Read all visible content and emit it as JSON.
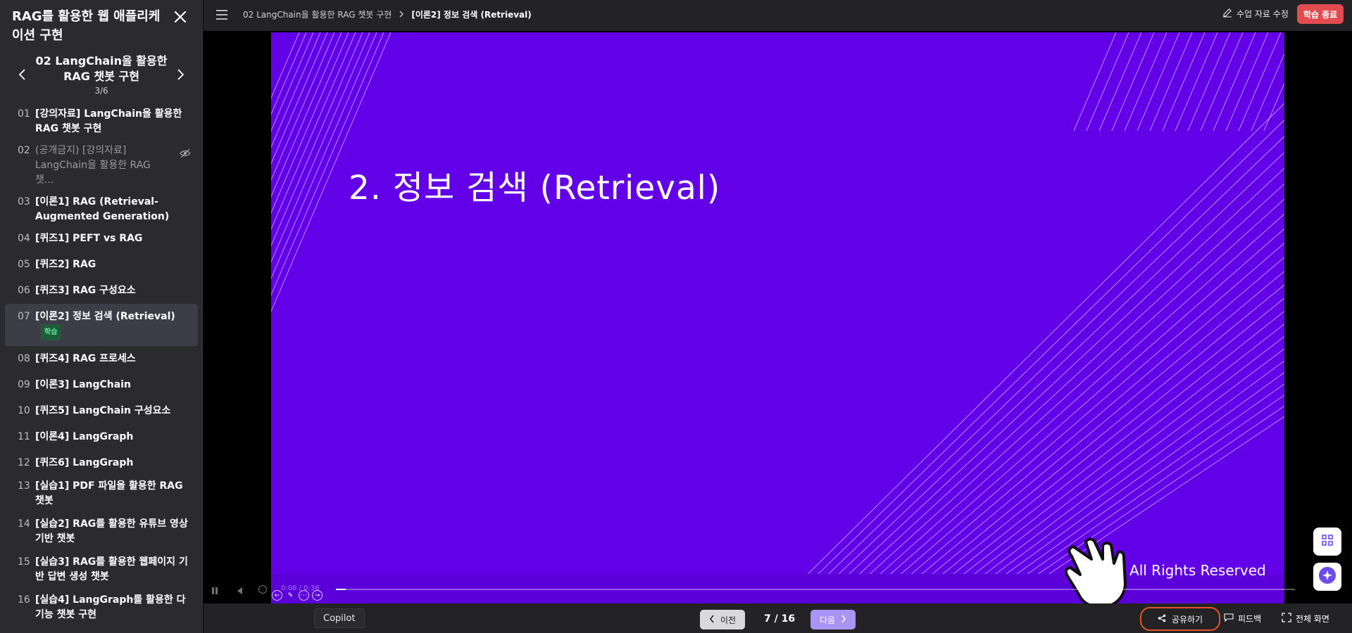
{
  "sidebar": {
    "course_title": "RAG를 활용한 웹 애플리케이션 구현",
    "chapter_title": "02 LangChain을 활용한 RAG 챗봇 구현",
    "chapter_count": "3/6",
    "lessons": [
      {
        "num": "01",
        "label": "[강의자료] LangChain을 활용한 RAG 챗봇 구현"
      },
      {
        "num": "02",
        "label": "(공개금지) [강의자료] LangChain을 활용한 RAG 챗..."
      },
      {
        "num": "03",
        "label": "[이론1] RAG (Retrieval-Augmented Generation)"
      },
      {
        "num": "04",
        "label": "[퀴즈1] PEFT vs RAG"
      },
      {
        "num": "05",
        "label": "[퀴즈2] RAG"
      },
      {
        "num": "06",
        "label": "[퀴즈3] RAG 구성요소"
      },
      {
        "num": "07",
        "label": "[이론2] 정보 검색 (Retrieval)",
        "badge": "학습"
      },
      {
        "num": "08",
        "label": "[퀴즈4] RAG 프로세스"
      },
      {
        "num": "09",
        "label": "[이론3] LangChain"
      },
      {
        "num": "10",
        "label": "[퀴즈5] LangChain 구성요소"
      },
      {
        "num": "11",
        "label": "[이론4] LangGraph"
      },
      {
        "num": "12",
        "label": "[퀴즈6] LangGraph"
      },
      {
        "num": "13",
        "label": "[실습1] PDF 파일을 활용한 RAG 챗봇"
      },
      {
        "num": "14",
        "label": "[실습2] RAG를 활용한 유튜브 영상 기반 챗봇"
      },
      {
        "num": "15",
        "label": "[실습3] RAG를 활용한 웹페이지 기반 답변 생성 챗봇"
      },
      {
        "num": "16",
        "label": "[실습4] LangGraph를 활용한 다기능 챗봇 구현"
      }
    ]
  },
  "topbar": {
    "breadcrumb_parent": "02 LangChain을 활용한 RAG 챗봇 구현",
    "breadcrumb_current": "[이론2] 정보 검색 (Retrieval)",
    "edit_label": "수업 자료 수정",
    "end_label": "학습 종료"
  },
  "slide": {
    "heading": "2. 정보 검색 (Retrieval)",
    "copyright": "e. All Rights Reserved"
  },
  "player": {
    "time": "0:06 / 0:36",
    "progress": 0.01
  },
  "bottombar": {
    "copilot_label": "Copilot",
    "prev_label": "이전",
    "page_indicator": "7 / 16",
    "next_label": "다음",
    "share_label": "공유하기",
    "feedback_label": "피드백",
    "fullscreen_label": "전체 화면"
  },
  "colors": {
    "slide_bg": "#6200e8",
    "end_button": "#e24b4f",
    "next_button": "#a894f5",
    "share_outline": "#e2542a",
    "badge_text": "#5ee39c"
  }
}
